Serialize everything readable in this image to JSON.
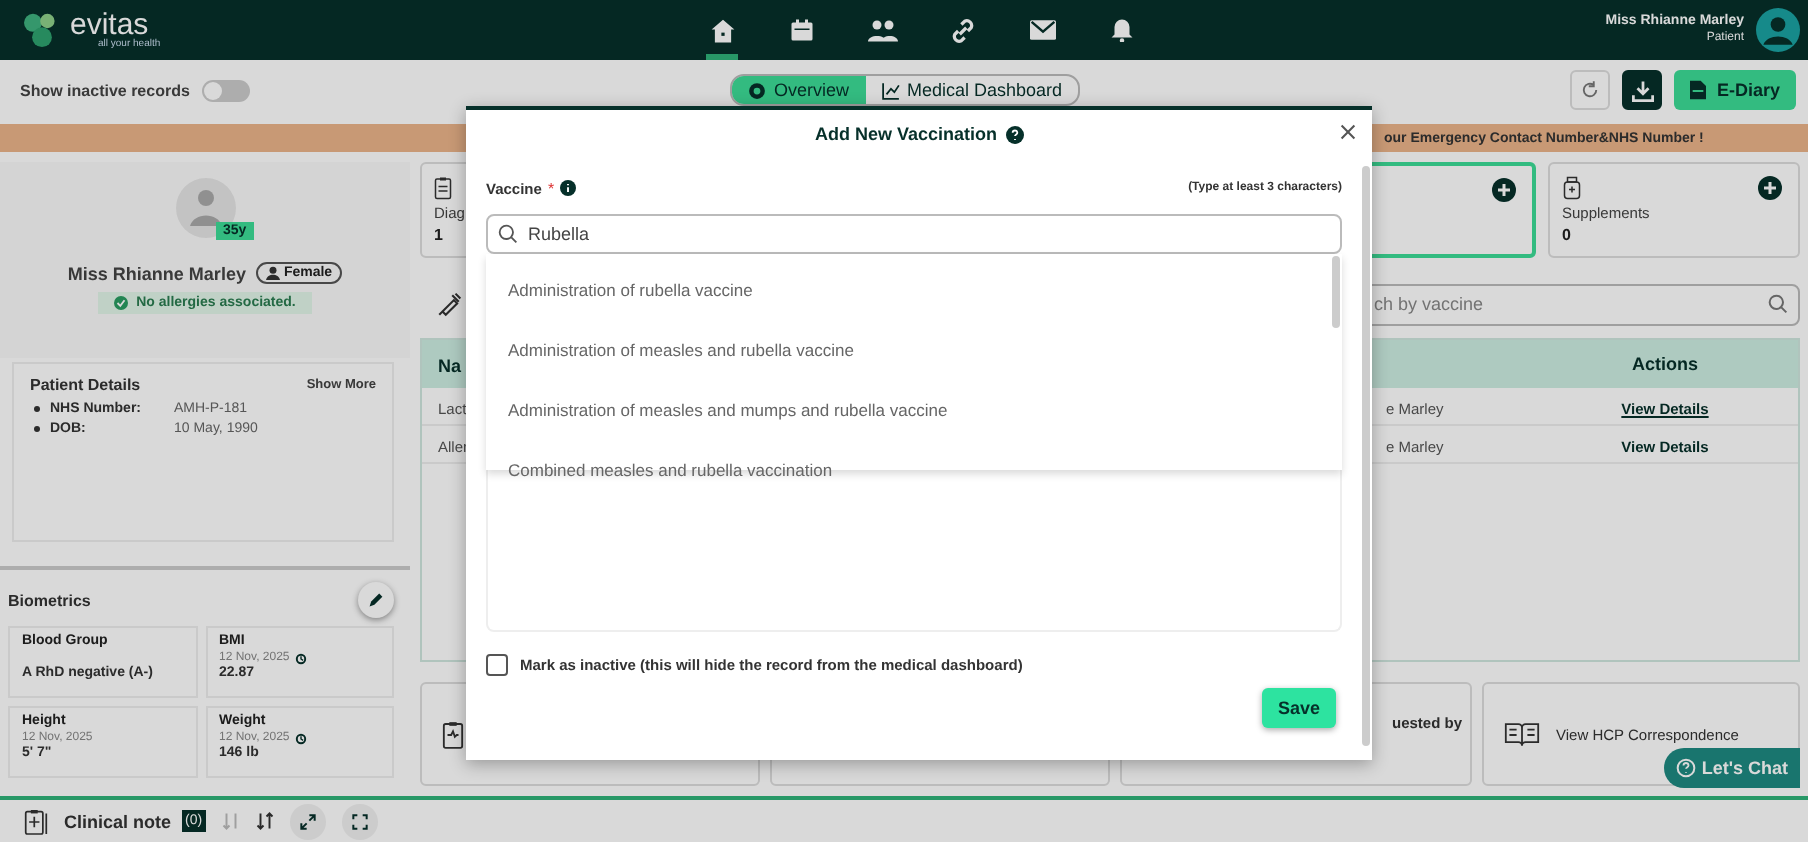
{
  "header": {
    "logo": "evitas",
    "tagline": "all your health",
    "nav": [
      {
        "kind": "home",
        "selected": true
      },
      {
        "kind": "calendar",
        "selected": false
      },
      {
        "kind": "people",
        "selected": false
      },
      {
        "kind": "link",
        "selected": false
      },
      {
        "kind": "mail",
        "selected": false
      },
      {
        "kind": "bell",
        "selected": false
      }
    ],
    "user": {
      "name": "Miss Rhianne Marley",
      "role": "Patient"
    }
  },
  "toolbar": {
    "toggle": {
      "label": "Show inactive records",
      "on": false
    },
    "tabs": [
      {
        "label": "Overview",
        "kind": "eye",
        "selected": true
      },
      {
        "label": "Medical Dashboard",
        "kind": "chart",
        "selected": false
      }
    ],
    "ediary": "E-Diary"
  },
  "banner": "our Emergency Contact Number&NHS Number !",
  "patient": {
    "age": "35y",
    "name": "Miss Rhianne Marley",
    "gender": "Female",
    "allergies": "No allergies associated."
  },
  "patient_details": {
    "title": "Patient Details",
    "show_more": "Show More",
    "fields": [
      {
        "label": "NHS Number:",
        "value": "AMH-P-181"
      },
      {
        "label": "DOB:",
        "value": "10 May, 1990"
      }
    ]
  },
  "biometrics": {
    "title": "Biometrics",
    "items": [
      {
        "label": "Blood Group",
        "value": "A RhD negative (A-)",
        "history": false
      },
      {
        "label": "BMI",
        "date": "12 Nov, 2025",
        "value": "22.87",
        "history": true
      },
      {
        "label": "Height",
        "date": "12 Nov, 2025",
        "value": "5' 7\"",
        "history": false
      },
      {
        "label": "Weight",
        "date": "12 Nov, 2025",
        "value": "146 lb",
        "history": true
      }
    ]
  },
  "summary_cards": [
    {
      "label": "Diag",
      "count": "1",
      "kind": "clipboard",
      "selected": false
    },
    {
      "kind": "none",
      "selected": true
    },
    {
      "label": "Supplements",
      "count": "0",
      "kind": "bottle",
      "selected": false
    }
  ],
  "vaccine_search": {
    "placeholder": "ch by vaccine"
  },
  "table": {
    "columns": [
      "Na",
      "Actions"
    ],
    "rows": [
      {
        "column_1": "Lact",
        "column_3": "e Marley",
        "action": "View Details",
        "hovered": true
      },
      {
        "column_1": "Aller",
        "column_3": "e Marley",
        "action": "View Details",
        "hovered": false
      }
    ]
  },
  "bottom_cards": [
    {
      "kind": "clipboard"
    },
    {
      "kind": "none"
    },
    {
      "kind": "none",
      "label": "uested by"
    },
    {
      "kind": "book",
      "label": "View HCP Correspondence"
    }
  ],
  "chat": "Let's Chat",
  "clinical_note": {
    "label": "Clinical note",
    "count": "(0)"
  },
  "modal": {
    "title": "Add New Vaccination",
    "field_label": "Vaccine",
    "required_mark": "*",
    "hint": "(Type at least 3 characters)",
    "value": "Rubella",
    "options": [
      "Administration of rubella vaccine",
      "Administration of measles and rubella vaccine",
      "Administration of measles and mumps and rubella vaccine",
      "Combined measles and rubella vaccination"
    ],
    "inactive": {
      "label": "Mark as inactive (this will hide the record from the medical dashboard)",
      "checked": false
    },
    "save": "Save"
  }
}
